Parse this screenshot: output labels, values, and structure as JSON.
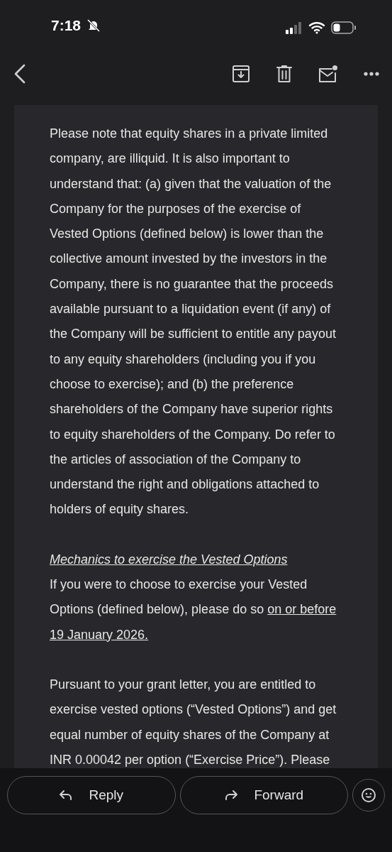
{
  "status_bar": {
    "time": "7:18"
  },
  "paragraphs": [
    {
      "kind": "body",
      "segments": [
        {
          "text": "Please note that equity shares in a private limited company, are illiquid. It is also important to understand that: (a) given that the valuation of the Company for the purposes of the exercise of Vested Options (defined below) is lower than the collective amount invested by the investors in the Company, there is no guarantee that the proceeds available pursuant to a liquidation event (if any) of the Company will be sufficient to entitle any payout to any equity shareholders (including you if you choose to exercise); and (b) the preference shareholders of the Company have superior rights to equity shareholders of the Company. Do refer to the articles of association of the Company to understand the right and obligations attached to holders of equity shares.",
          "underlined": false
        }
      ]
    },
    {
      "kind": "heading",
      "segments": [
        {
          "text": "Mechanics to exercise the Vested Options",
          "underlined": true
        }
      ]
    },
    {
      "kind": "body",
      "segments": [
        {
          "text": "If you were to choose to exercise your Vested Options (defined below), please do so ",
          "underlined": false
        },
        {
          "text": "on or before 19 January 2026.",
          "underlined": true
        }
      ]
    },
    {
      "kind": "body",
      "segments": [
        {
          "text": "Pursuant to your grant letter, you are entitled to exercise vested options (“Vested Options”) and get equal number of equity shares of the Company at INR 0.00042 per option (“Exercise Price”). Please",
          "underlined": false
        }
      ]
    }
  ],
  "actions": [
    {
      "label": "Reply",
      "kind": "reply"
    },
    {
      "label": "Forward",
      "kind": "forward"
    }
  ]
}
